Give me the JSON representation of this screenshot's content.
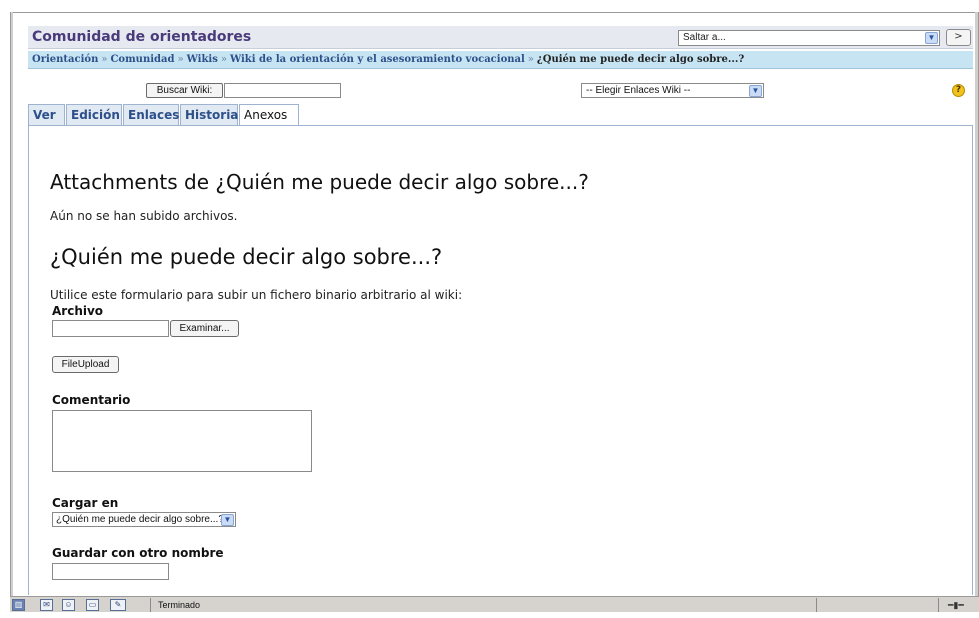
{
  "header": {
    "title": "Comunidad de orientadores",
    "jump_select": "Saltar a...",
    "go_label": ">"
  },
  "breadcrumb": {
    "items": [
      "Orientación",
      "Comunidad",
      "Wikis",
      "Wiki de la orientación y el asesoramiento vocacional"
    ],
    "separator": "»",
    "current": "¿Quién me puede decir algo sobre...?"
  },
  "wiki_tools": {
    "search_button": "Buscar Wiki:",
    "search_value": "",
    "links_select": "-- Elegir Enlaces Wiki --"
  },
  "tabs": [
    {
      "label": "Ver",
      "active": false
    },
    {
      "label": "Edición",
      "active": false
    },
    {
      "label": "Enlaces",
      "active": false
    },
    {
      "label": "Historia",
      "active": false
    },
    {
      "label": "Anexos",
      "active": true
    }
  ],
  "main": {
    "attachments_heading": "Attachments de ¿Quién me puede decir algo sobre...?",
    "no_files": "Aún no se han subido archivos.",
    "page_heading": "¿Quién me puede decir algo sobre...?",
    "instructions": "Utilice este formulario para subir un fichero binario arbitrario al wiki:",
    "file_label": "Archivo",
    "browse_button": "Examinar...",
    "upload_button": "FileUpload",
    "comment_label": "Comentario",
    "target_label": "Cargar en",
    "target_value": "¿Quién me puede decir algo sobre...?",
    "rename_label": "Guardar con otro nombre"
  },
  "statusbar": {
    "text": "Terminado",
    "icons": [
      "app-icon",
      "mail-icon",
      "people-icon",
      "page-icon",
      "edit-icon"
    ]
  }
}
